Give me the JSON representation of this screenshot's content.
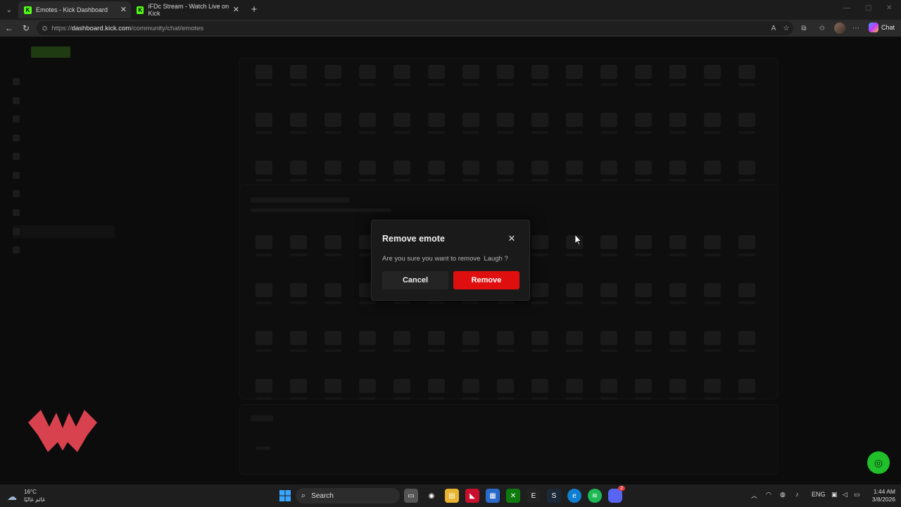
{
  "tabs": [
    {
      "title": "Emotes - Kick Dashboard",
      "favicon": "K",
      "active": true
    },
    {
      "title": "iFDc Stream - Watch Live on Kick",
      "favicon": "K",
      "active": false
    }
  ],
  "address": {
    "prefix": "https://",
    "host": "dashboard.kick.com",
    "path": "/community/chat/emotes"
  },
  "toolbar": {
    "copilot_label": "Chat"
  },
  "modal": {
    "title": "Remove emote",
    "message": "Are you sure you want to remove",
    "emote_name": "Laugh ?",
    "cancel_label": "Cancel",
    "remove_label": "Remove",
    "remove_color": "#e00f0f"
  },
  "taskbar": {
    "weather_temp": "16°C",
    "weather_desc": "غائم غالبًا",
    "search_label": "Search",
    "language": "ENG",
    "time": "1:44 AM",
    "date": "3/8/2026",
    "discord_badge": "2"
  },
  "colors": {
    "kick_green": "#53fc18",
    "accent_red": "#e00f0f",
    "support_green": "#1fc02a"
  }
}
